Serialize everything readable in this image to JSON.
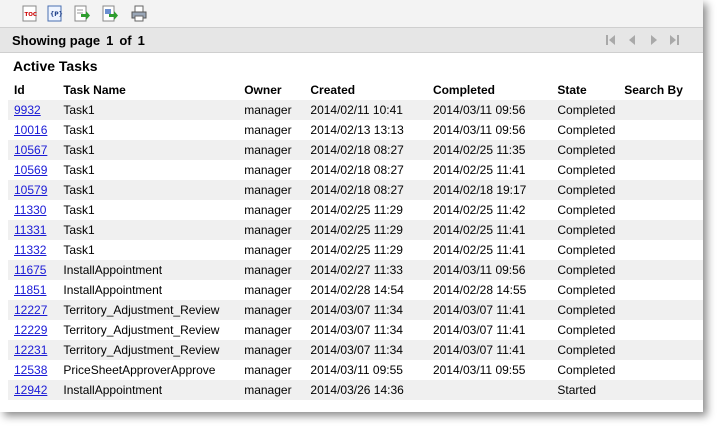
{
  "toolbar": {
    "buttons": [
      "toc-icon",
      "params-icon",
      "export-icon",
      "export-data-icon",
      "print-icon"
    ]
  },
  "pager": {
    "showing_label": "Showing page",
    "page": "1",
    "of_label": "of",
    "total": "1"
  },
  "section_title": "Active Tasks",
  "table": {
    "headers": [
      "Id",
      "Task Name",
      "Owner",
      "Created",
      "Completed",
      "State",
      "Search By"
    ],
    "rows": [
      {
        "id": "9932",
        "name": "Task1",
        "owner": "manager",
        "created": "2014/02/11 10:41",
        "completed": "2014/03/11 09:56",
        "state": "Completed"
      },
      {
        "id": "10016",
        "name": "Task1",
        "owner": "manager",
        "created": "2014/02/13 13:13",
        "completed": "2014/03/11 09:56",
        "state": "Completed"
      },
      {
        "id": "10567",
        "name": "Task1",
        "owner": "manager",
        "created": "2014/02/18 08:27",
        "completed": "2014/02/25 11:35",
        "state": "Completed"
      },
      {
        "id": "10569",
        "name": "Task1",
        "owner": "manager",
        "created": "2014/02/18 08:27",
        "completed": "2014/02/25 11:41",
        "state": "Completed"
      },
      {
        "id": "10579",
        "name": "Task1",
        "owner": "manager",
        "created": "2014/02/18 08:27",
        "completed": "2014/02/18 19:17",
        "state": "Completed"
      },
      {
        "id": "11330",
        "name": "Task1",
        "owner": "manager",
        "created": "2014/02/25 11:29",
        "completed": "2014/02/25 11:42",
        "state": "Completed"
      },
      {
        "id": "11331",
        "name": "Task1",
        "owner": "manager",
        "created": "2014/02/25 11:29",
        "completed": "2014/02/25 11:41",
        "state": "Completed"
      },
      {
        "id": "11332",
        "name": "Task1",
        "owner": "manager",
        "created": "2014/02/25 11:29",
        "completed": "2014/02/25 11:41",
        "state": "Completed"
      },
      {
        "id": "11675",
        "name": "InstallAppointment",
        "owner": "manager",
        "created": "2014/02/27 11:33",
        "completed": "2014/03/11 09:56",
        "state": "Completed"
      },
      {
        "id": "11851",
        "name": "InstallAppointment",
        "owner": "manager",
        "created": "2014/02/28 14:54",
        "completed": "2014/02/28 14:55",
        "state": "Completed"
      },
      {
        "id": "12227",
        "name": "Territory_Adjustment_Review",
        "owner": "manager",
        "created": "2014/03/07 11:34",
        "completed": "2014/03/07 11:41",
        "state": "Completed"
      },
      {
        "id": "12229",
        "name": "Territory_Adjustment_Review",
        "owner": "manager",
        "created": "2014/03/07 11:34",
        "completed": "2014/03/07 11:41",
        "state": "Completed"
      },
      {
        "id": "12231",
        "name": "Territory_Adjustment_Review",
        "owner": "manager",
        "created": "2014/03/07 11:34",
        "completed": "2014/03/07 11:41",
        "state": "Completed"
      },
      {
        "id": "12538",
        "name": "PriceSheetApproverApprove",
        "owner": "manager",
        "created": "2014/03/11 09:55",
        "completed": "2014/03/11 09:55",
        "state": "Completed"
      },
      {
        "id": "12942",
        "name": "InstallAppointment",
        "owner": "manager",
        "created": "2014/03/26 14:36",
        "completed": "",
        "state": "Started"
      }
    ]
  }
}
